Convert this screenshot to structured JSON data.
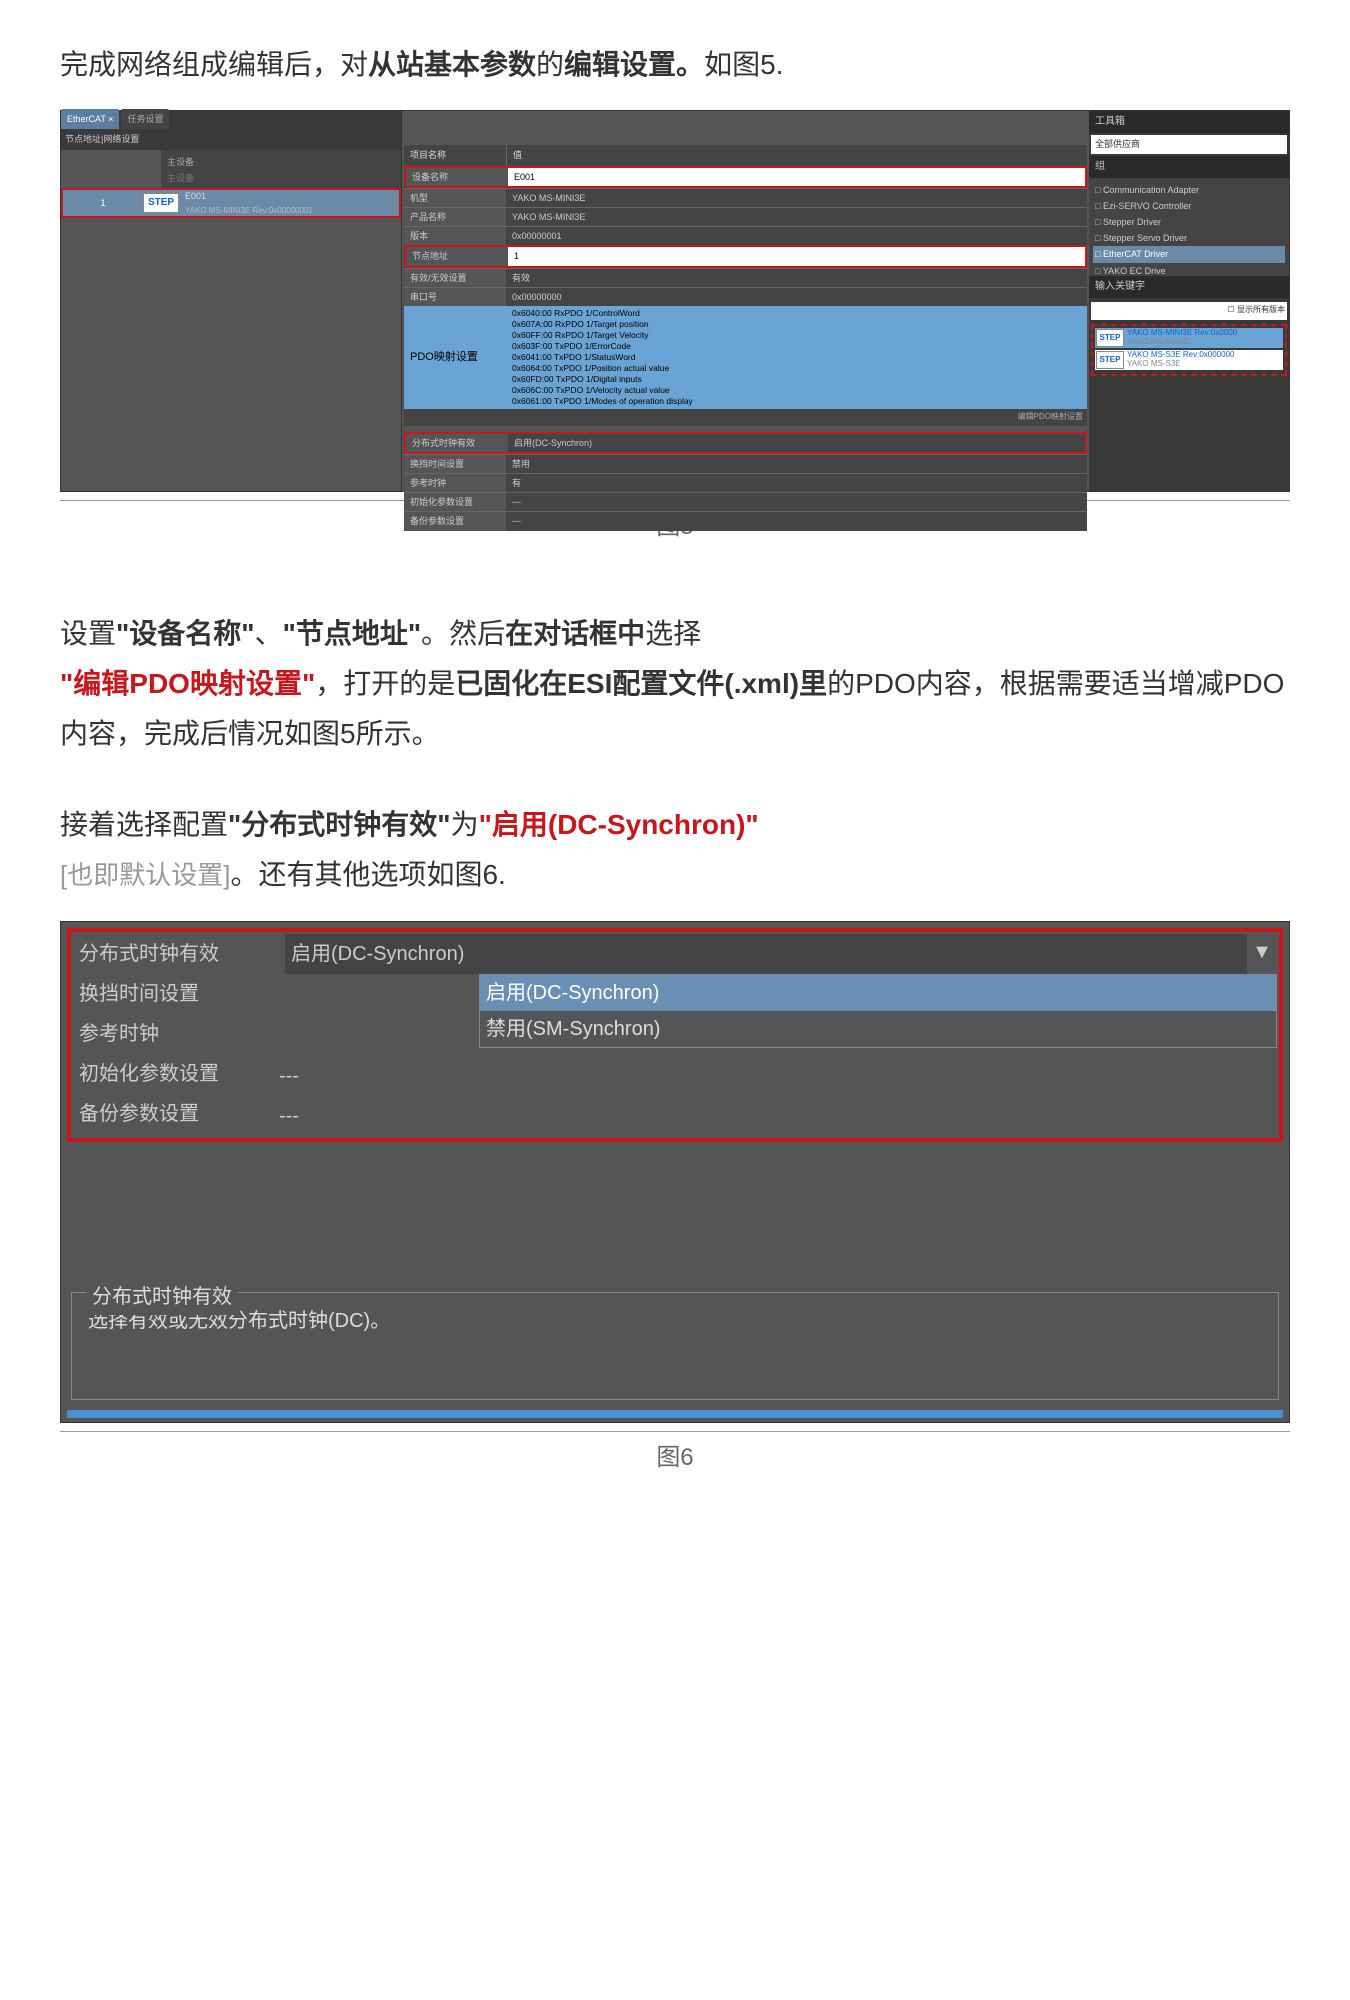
{
  "intro": {
    "t1": "完成网络组成编辑后，对",
    "t2": "从站基本参数",
    "t3": "的",
    "t4": "编辑设置。",
    "t5": "如图5."
  },
  "fig5": {
    "caption": "图5",
    "tabs": {
      "active": "EtherCAT ×",
      "inactive": "任务设置"
    },
    "crumb": "节点地址|网络设置",
    "master": {
      "l1": "主设备",
      "l2": "主设备"
    },
    "slave": {
      "num": "1",
      "badge": "STEP",
      "label": "E001",
      "sub": "YAKO MS-MINI3E Rev:0x00000001"
    },
    "propHeader": {
      "name": "项目名称",
      "val": "值"
    },
    "rows": [
      {
        "k": "设备名称",
        "v": "E001",
        "white": true
      },
      {
        "k": "机型",
        "v": "YAKO MS-MINI3E",
        "white": false
      },
      {
        "k": "产品名称",
        "v": "YAKO MS-MINI3E",
        "white": false
      },
      {
        "k": "版本",
        "v": "0x00000001",
        "white": false
      },
      {
        "k": "节点地址",
        "v": "1",
        "white": true
      },
      {
        "k": "有效/无效设置",
        "v": "有效",
        "white": false
      },
      {
        "k": "串口号",
        "v": "0x00000000",
        "white": false
      }
    ],
    "pdo": {
      "k": "PDO映射设置",
      "lines": [
        "0x6040:00 RxPDO 1/ControlWord",
        "0x607A:00 RxPDO 1/Target position",
        "0x60FF:00 RxPDO 1/Target Velocity",
        "0x603F:00 TxPDO 1/ErrorCode",
        "0x6041:00 TxPDO 1/StatusWord",
        "0x6064:00 TxPDO 1/Position actual value",
        "0x60FD:00 TxPDO 1/Digital inputs",
        "0x606C:00 TxPDO 1/Velocity actual value",
        "0x6061:00 TxPDO 1/Modes of operation display"
      ],
      "edit": "编辑PDO映射设置"
    },
    "dcrow": {
      "k": "分布式时钟有效",
      "v": "启用(DC-Synchron)"
    },
    "bottomRows": [
      {
        "k": "换挡时间设置",
        "v": "禁用"
      },
      {
        "k": "参考时钟",
        "v": "有"
      },
      {
        "k": "初始化参数设置",
        "v": "---"
      },
      {
        "k": "备份参数设置",
        "v": "---"
      }
    ],
    "toolbox": {
      "title": "工具箱",
      "combo": "全部供应商",
      "groupLabel": "组",
      "tree": [
        "Communication Adapter",
        "Ezi-SERVO Controller",
        "Stepper Driver",
        "Stepper Servo Driver",
        "EtherCAT Driver",
        "YAKO EC Drive"
      ],
      "selIndex": 4,
      "kwLabel": "输入关键字",
      "chk": "显示所有版本",
      "results": [
        {
          "t1": "YAKO MS-MINI3E Rev:0x0000",
          "t2": "YAKO MS-MINI3E"
        },
        {
          "t1": "YAKO MS-S3E Rev:0x000000",
          "t2": "YAKO MS-S3E"
        }
      ]
    }
  },
  "para2": {
    "t1": "设置",
    "t2": "\"设备名称\"",
    "t3": "、",
    "t4": "\"节点地址\"",
    "t5": "。然后",
    "t6": "在对话框中",
    "t7": "选择",
    "t8": "\"编辑PDO映射设置\"",
    "t9": "，打开的是",
    "t10": "已固化在ESI配置文件(.xml)里",
    "t11": "的PDO内容，根据需要适当增减PDO内容，完成后情况如图5所示。"
  },
  "para3": {
    "t1": "接着选择配置",
    "t2": "\"分布式时钟有效\"",
    "t3": "为",
    "t4": "\"启用(DC-Synchron)\"",
    "t5": "[也即默认设置]",
    "t6": "。还有其他选项如图6."
  },
  "fig6": {
    "caption": "图6",
    "rows": [
      {
        "k": "分布式时钟有效",
        "v": "启用(DC-Synchron)"
      }
    ],
    "opts": [
      "启用(DC-Synchron)",
      "禁用(SM-Synchron)"
    ],
    "extraRows": [
      {
        "k": "换挡时间设置",
        "v": ""
      },
      {
        "k": "参考时钟",
        "v": ""
      },
      {
        "k": "初始化参数设置",
        "v": "---"
      },
      {
        "k": "备份参数设置",
        "v": "---"
      }
    ],
    "desc": {
      "title": "分布式时钟有效",
      "body": "选择有效或无效分布式时钟(DC)。"
    }
  }
}
